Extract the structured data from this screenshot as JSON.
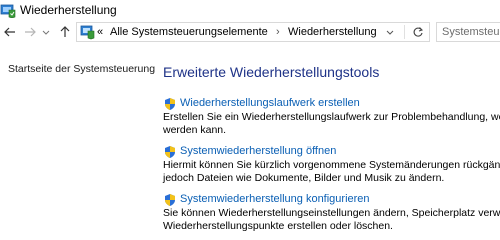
{
  "window": {
    "title": "Wiederherstellung",
    "icon": "recovery-shield-icon"
  },
  "navigation": {
    "back_icon": "back-arrow-icon",
    "forward_icon": "forward-arrow-icon",
    "recent_icon": "chevron-down-icon",
    "up_icon": "up-arrow-icon",
    "address": {
      "icon": "control-panel-icon",
      "overflow": "«",
      "segments": [
        "Alle Systemsteuerungselemente",
        "Wiederherstellung"
      ],
      "separator": "›",
      "dropdown_icon": "chevron-down-icon",
      "refresh_icon": "refresh-icon"
    },
    "search": {
      "placeholder": "Systemsteuerung durchsuchen"
    }
  },
  "sidebar": {
    "link": "Startseite der Systemsteuerung"
  },
  "main": {
    "title": "Erweiterte Wiederherstellungstools",
    "tasks": [
      {
        "icon": "uac-shield-icon",
        "link": "Wiederherstellungslaufwerk erstellen",
        "desc": [
          "Erstellen Sie ein Wiederherstellungslaufwerk zur Problembehandlung, wenn der PC",
          "werden kann."
        ]
      },
      {
        "icon": "uac-shield-icon",
        "link": "Systemwiederherstellung öffnen",
        "desc": [
          "Hiermit können Sie kürzlich vorgenommene Systemänderungen rückgängig mach",
          "jedoch Dateien wie Dokumente, Bilder und Musik zu ändern."
        ]
      },
      {
        "icon": "uac-shield-icon",
        "link": "Systemwiederherstellung konfigurieren",
        "desc": [
          "Sie können Wiederherstellungseinstellungen ändern, Speicherplatz verwalten und",
          "Wiederherstellungspunkte erstellen oder löschen."
        ]
      }
    ]
  },
  "colors": {
    "link": "#0a5fb4",
    "heading": "#1e3287"
  }
}
